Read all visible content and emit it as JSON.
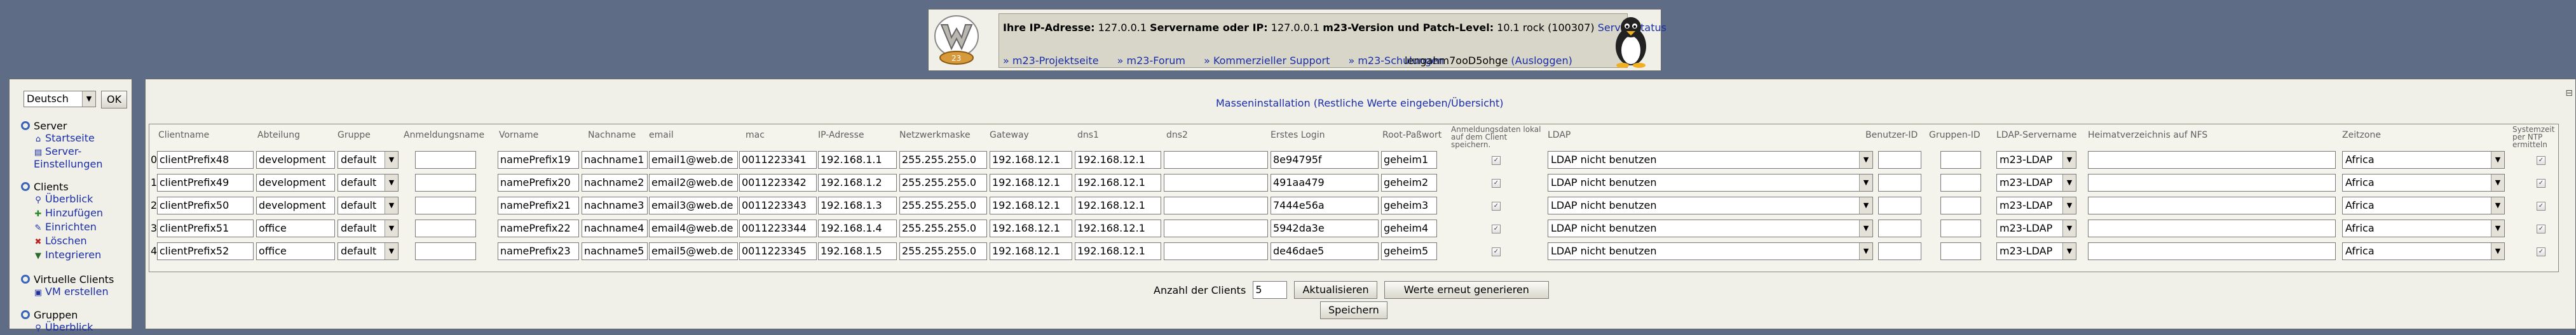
{
  "header": {
    "ip_label": "Ihre IP-Adresse:",
    "ip_value": "127.0.0.1",
    "servername_label": "Servername oder IP:",
    "servername_value": "127.0.0.1",
    "version_label": "m23-Version und Patch-Level:",
    "version_value": "10.1 rock (100307)",
    "server_status": "Server-Status",
    "links": [
      "» m23-Projektseite",
      "» m23-Forum",
      "» Kommerzieller Support",
      "» m23-Schulungen"
    ],
    "username": "lengahm7ooD5ohge",
    "logout": "(Ausloggen)"
  },
  "sidebar": {
    "language": "Deutsch",
    "ok_label": "OK",
    "groups": [
      {
        "title": "Server",
        "items": [
          {
            "label": "Startseite",
            "icon": "home-icon"
          },
          {
            "label": "Server-Einstellungen",
            "icon": "settings-icon"
          }
        ]
      },
      {
        "title": "Clients",
        "items": [
          {
            "label": "Überblick",
            "icon": "magnifier-icon"
          },
          {
            "label": "Hinzufügen",
            "icon": "add-icon"
          },
          {
            "label": "Einrichten",
            "icon": "wrench-icon"
          },
          {
            "label": "Löschen",
            "icon": "delete-icon"
          },
          {
            "label": "Integrieren",
            "icon": "integrate-icon"
          }
        ]
      },
      {
        "title": "Virtuelle Clients",
        "items": [
          {
            "label": "VM erstellen",
            "icon": "vm-icon"
          }
        ]
      },
      {
        "title": "Gruppen",
        "items": [
          {
            "label": "Überblick",
            "icon": "magnifier-icon"
          }
        ]
      }
    ]
  },
  "main": {
    "title": "Masseninstallation (Restliche Werte eingeben/Übersicht)",
    "columns": {
      "clientname": "Clientname",
      "abteilung": "Abteilung",
      "gruppe": "Gruppe",
      "anmeldungsname": "Anmeldungsname",
      "vorname": "Vorname",
      "nachname": "Nachname",
      "email": "email",
      "mac": "mac",
      "ip": "IP-Adresse",
      "netmask": "Netzwerkmaske",
      "gateway": "Gateway",
      "dns1": "dns1",
      "dns2": "dns2",
      "erster_login": "Erstes Login",
      "root_passwort": "Root-Paßwort",
      "anmeldedaten": "Anmeldungsdaten lokal auf dem Client speichern.",
      "ldap": "LDAP",
      "benutzer_id": "Benutzer-ID",
      "gruppen_id": "Gruppen-ID",
      "ldap_servername": "LDAP-Servername",
      "heimat": "Heimatverzeichnis auf NFS",
      "zeitzone": "Zeitzone",
      "ntp": "Systemzeit per NTP ermitteln"
    },
    "rows": [
      {
        "index": "0",
        "client": "clientPrefix48",
        "abteilung": "development",
        "gruppe": "default",
        "anmeldung": "",
        "vorname": "namePrefix19",
        "nachname": "nachname1",
        "email": "email1@web.de",
        "mac": "0011223341",
        "ip": "192.168.1.1",
        "netmask": "255.255.255.0",
        "gateway": "192.168.12.1",
        "dns1": "192.168.12.1",
        "dns2": "",
        "login": "8e94795f",
        "root": "geheim1",
        "ldap": "LDAP nicht benutzen",
        "uid": "",
        "gid": "",
        "ldapserver": "m23-LDAP",
        "heimat": "",
        "zone": "Africa"
      },
      {
        "index": "1",
        "client": "clientPrefix49",
        "abteilung": "development",
        "gruppe": "default",
        "anmeldung": "",
        "vorname": "namePrefix20",
        "nachname": "nachname2",
        "email": "email2@web.de",
        "mac": "0011223342",
        "ip": "192.168.1.2",
        "netmask": "255.255.255.0",
        "gateway": "192.168.12.1",
        "dns1": "192.168.12.1",
        "dns2": "",
        "login": "491aa479",
        "root": "geheim2",
        "ldap": "LDAP nicht benutzen",
        "uid": "",
        "gid": "",
        "ldapserver": "m23-LDAP",
        "heimat": "",
        "zone": "Africa"
      },
      {
        "index": "2",
        "client": "clientPrefix50",
        "abteilung": "development",
        "gruppe": "default",
        "anmeldung": "",
        "vorname": "namePrefix21",
        "nachname": "nachname3",
        "email": "email3@web.de",
        "mac": "0011223343",
        "ip": "192.168.1.3",
        "netmask": "255.255.255.0",
        "gateway": "192.168.12.1",
        "dns1": "192.168.12.1",
        "dns2": "",
        "login": "7444e56a",
        "root": "geheim3",
        "ldap": "LDAP nicht benutzen",
        "uid": "",
        "gid": "",
        "ldapserver": "m23-LDAP",
        "heimat": "",
        "zone": "Africa"
      },
      {
        "index": "3",
        "client": "clientPrefix51",
        "abteilung": "office",
        "gruppe": "default",
        "anmeldung": "",
        "vorname": "namePrefix22",
        "nachname": "nachname4",
        "email": "email4@web.de",
        "mac": "0011223344",
        "ip": "192.168.1.4",
        "netmask": "255.255.255.0",
        "gateway": "192.168.12.1",
        "dns1": "192.168.12.1",
        "dns2": "",
        "login": "5942da3e",
        "root": "geheim4",
        "ldap": "LDAP nicht benutzen",
        "uid": "",
        "gid": "",
        "ldapserver": "m23-LDAP",
        "heimat": "",
        "zone": "Africa"
      },
      {
        "index": "4",
        "client": "clientPrefix52",
        "abteilung": "office",
        "gruppe": "default",
        "anmeldung": "",
        "vorname": "namePrefix23",
        "nachname": "nachname5",
        "email": "email5@web.de",
        "mac": "0011223345",
        "ip": "192.168.1.5",
        "netmask": "255.255.255.0",
        "gateway": "192.168.12.1",
        "dns1": "192.168.12.1",
        "dns2": "",
        "login": "de46dae5",
        "root": "geheim5",
        "ldap": "LDAP nicht benutzen",
        "uid": "",
        "gid": "",
        "ldapserver": "m23-LDAP",
        "heimat": "",
        "zone": "Africa"
      }
    ],
    "client_count_label": "Anzahl der Clients",
    "client_count": "5",
    "update_label": "Aktualisieren",
    "regenerate_label": "Werte erneut generieren",
    "save_label": "Speichern"
  },
  "colors": {
    "background": "#5e6d85",
    "panel": "#f0efe8",
    "link": "#1a2ea8"
  }
}
